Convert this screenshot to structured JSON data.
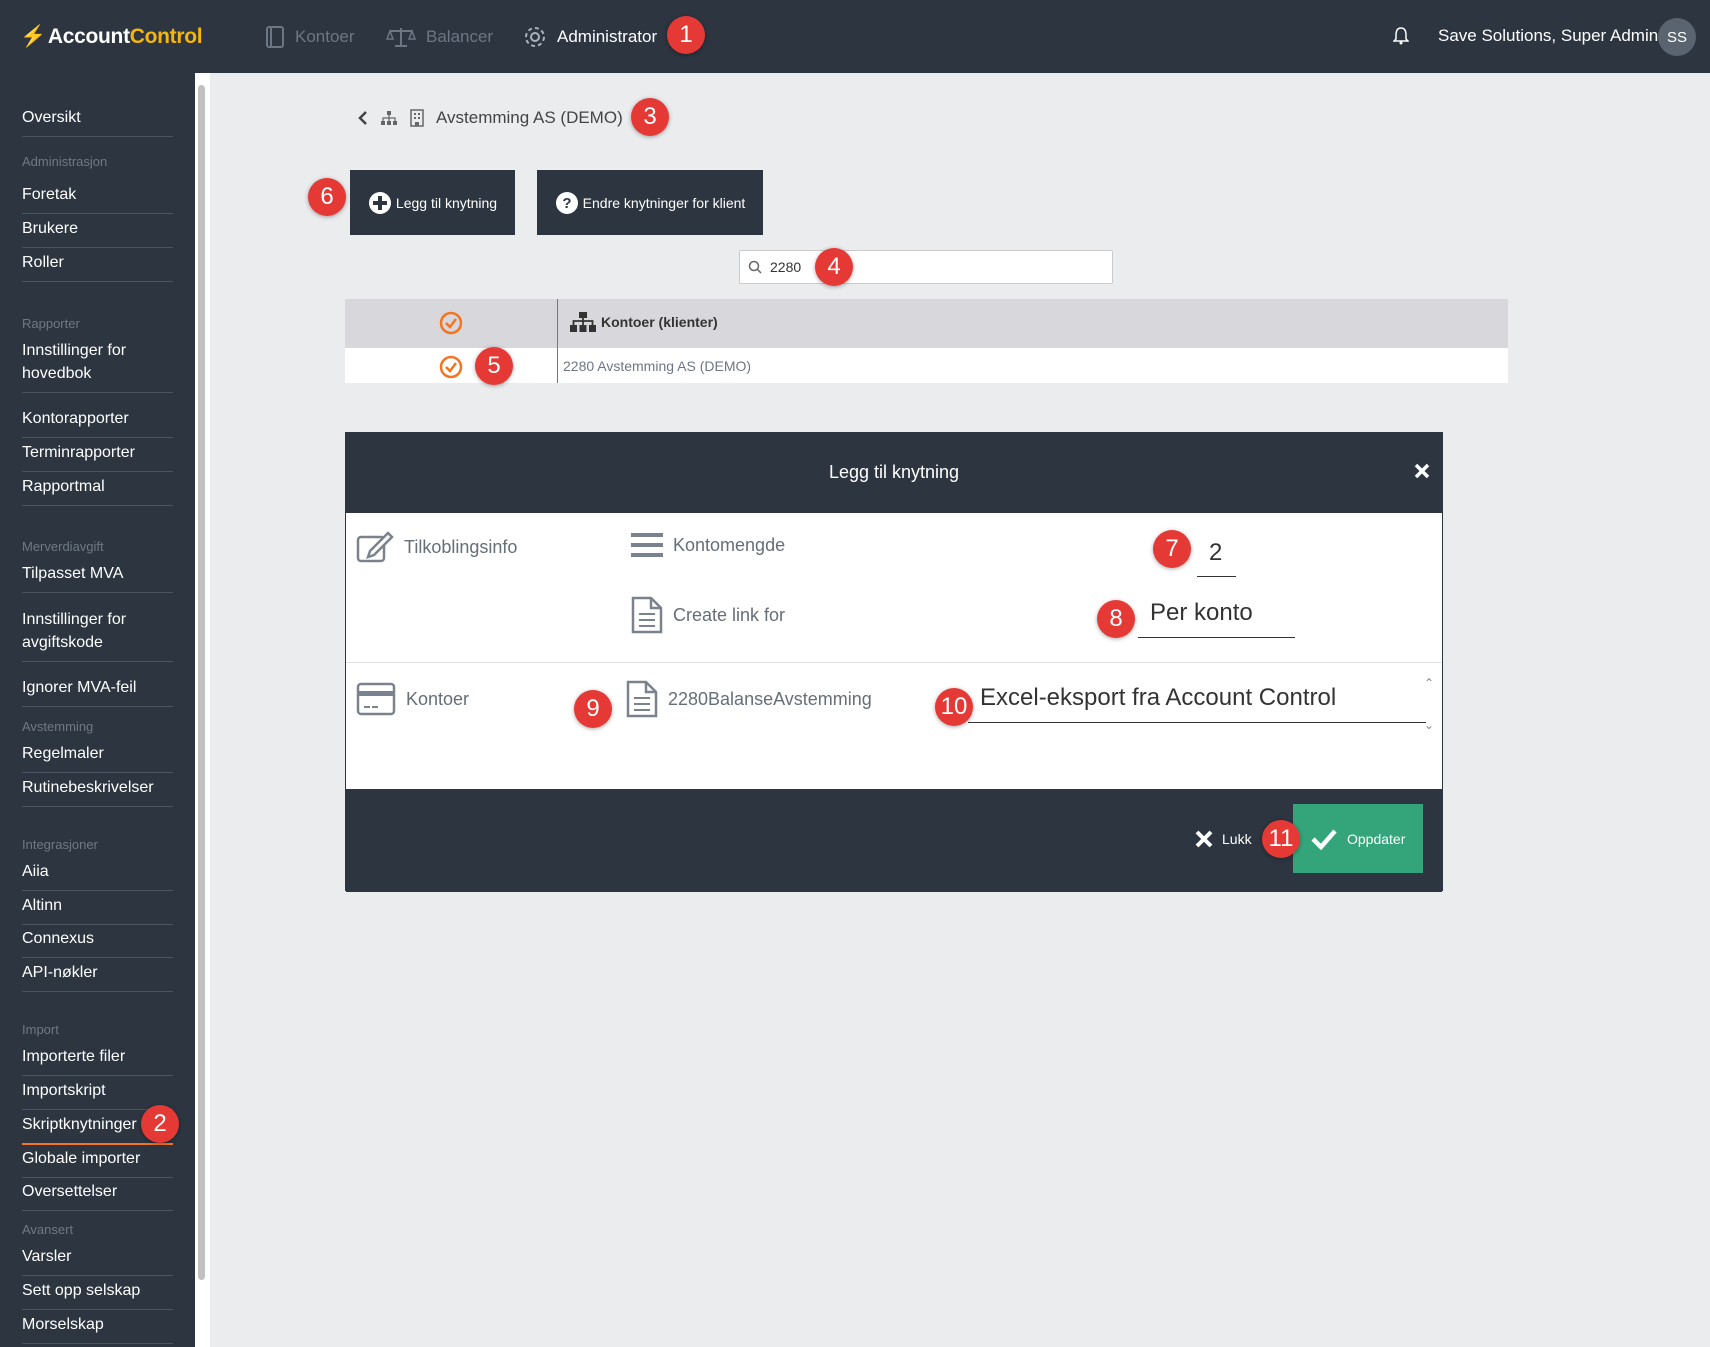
{
  "app": {
    "logo_account": "Account",
    "logo_control": "Control"
  },
  "topnav": {
    "items": [
      {
        "label": "Kontoer",
        "icon": "book-icon"
      },
      {
        "label": "Balancer",
        "icon": "scale-icon"
      },
      {
        "label": "Administrator",
        "icon": "gear-icon"
      }
    ],
    "user_name": "Save Solutions, Super Admin",
    "avatar_initials": "SS"
  },
  "sidebar": {
    "overview": "Oversikt",
    "groups": [
      {
        "title": "Administrasjon",
        "items": [
          "Foretak",
          "Brukere",
          "Roller"
        ]
      },
      {
        "title": "Rapporter",
        "items": [
          "Innstillinger for hovedbok",
          "Kontorapporter",
          "Terminrapporter",
          "Rapportmal"
        ]
      },
      {
        "title": "Merverdiavgift",
        "items": [
          "Tilpasset MVA",
          "Innstillinger for avgiftskode",
          "Ignorer MVA-feil"
        ]
      },
      {
        "title": "Avstemming",
        "items": [
          "Regelmaler",
          "Rutinebeskrivelser"
        ]
      },
      {
        "title": "Integrasjoner",
        "items": [
          "Aiia",
          "Altinn",
          "Connexus",
          "API-nøkler"
        ]
      },
      {
        "title": "Import",
        "items": [
          "Importerte filer",
          "Importskript",
          "Skriptknytninger",
          "Globale importer",
          "Oversettelser"
        ]
      },
      {
        "title": "Avansert",
        "items": [
          "Varsler",
          "Sett opp selskap",
          "Morselskap"
        ]
      }
    ],
    "active_item": "Skriptknytninger"
  },
  "breadcrumb": {
    "company": "Avstemming AS (DEMO)"
  },
  "actions": {
    "add_link": "Legg til knytning",
    "change_links": "Endre knytninger for klient"
  },
  "search": {
    "value": "2280"
  },
  "grid": {
    "header": "Kontoer (klienter)",
    "rows": [
      {
        "text": "2280 Avstemming AS (DEMO)",
        "checked": true
      }
    ]
  },
  "modal": {
    "title": "Legg til knytning",
    "tilkoblingsinfo_label": "Tilkoblingsinfo",
    "kontomengde_label": "Kontomengde",
    "kontomengde_value": "2",
    "create_link_label": "Create link for",
    "create_link_value": "Per konto",
    "kontoer_label": "Kontoer",
    "account_name": "2280BalanseAvstemming",
    "script_value": "Excel-eksport fra Account Control",
    "close_label": "Lukk",
    "update_label": "Oppdater"
  },
  "markers": [
    "1",
    "2",
    "3",
    "4",
    "5",
    "6",
    "7",
    "8",
    "9",
    "10",
    "11"
  ],
  "colors": {
    "dark": "#2c3540",
    "accent_orange": "#f47521",
    "logo_yellow": "#f5b50a",
    "success_green": "#34a57a",
    "marker_red": "#e53935"
  }
}
